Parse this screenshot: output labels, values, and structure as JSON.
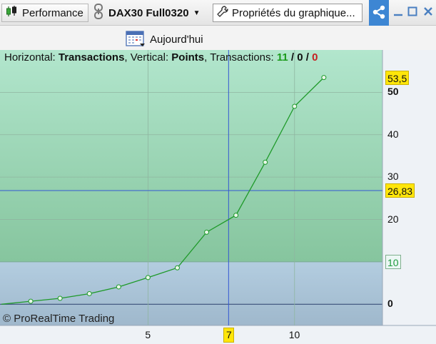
{
  "toolbar": {
    "performance_label": "Performance",
    "instrument_label": "DAX30 Full0320",
    "properties_label": "Propriétés du graphique..."
  },
  "today_label": "Aujourd'hui",
  "header": {
    "horizontal_label": "Horizontal: ",
    "horizontal_value": "Transactions",
    "vertical_label": ", Vertical: ",
    "vertical_value": "Points",
    "transactions_label": ", Transactions: ",
    "count_total": "11",
    "separator": " / ",
    "count_neutral": "0",
    "count_losses": "0"
  },
  "copyright": "© ProRealTime Trading",
  "colors": {
    "gain_zone": "#b7e4cf",
    "loss_zone": "#aec7d8",
    "line": "#1f9a2a",
    "crosshair": "#3457d3",
    "tag": "#ffe60a"
  },
  "chart_data": {
    "type": "line",
    "x": [
      0,
      1,
      2,
      3,
      4,
      5,
      6,
      7,
      8,
      9,
      10,
      11
    ],
    "values": [
      0,
      0.7,
      1.4,
      2.5,
      4.1,
      6.3,
      8.6,
      17.0,
      21.0,
      33.5,
      46.7,
      53.5
    ],
    "xlim": [
      0,
      13
    ],
    "ylim": [
      -5,
      60
    ],
    "x_ticks": [
      5,
      10
    ],
    "y_ticks": [
      0,
      20,
      30,
      40,
      50
    ],
    "last_value_tag": "53,5",
    "crosshair_value_tag": "26,83",
    "crosshair_x_tag": "7",
    "crosshair_x": 7.75,
    "crosshair_y": 26.83,
    "zero_zone_tag": "10",
    "zero_zone_level": 10
  }
}
